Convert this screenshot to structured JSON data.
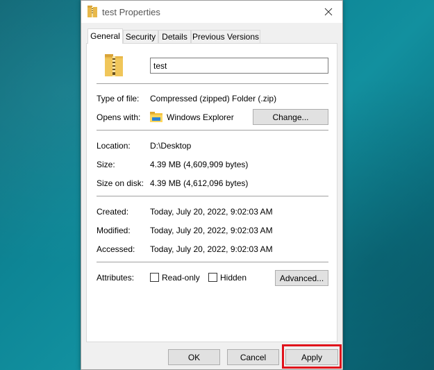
{
  "window": {
    "title": "test Properties"
  },
  "tabs": [
    {
      "label": "General",
      "active": true
    },
    {
      "label": "Security",
      "active": false
    },
    {
      "label": "Details",
      "active": false
    },
    {
      "label": "Previous Versions",
      "active": false
    }
  ],
  "general": {
    "name_value": "test",
    "type_label": "Type of file:",
    "type_value": "Compressed (zipped) Folder (.zip)",
    "opens_label": "Opens with:",
    "opens_value": "Windows Explorer",
    "change_button": "Change...",
    "location_label": "Location:",
    "location_value": "D:\\Desktop",
    "size_label": "Size:",
    "size_value": "4.39 MB (4,609,909 bytes)",
    "disk_label": "Size on disk:",
    "disk_value": "4.39 MB (4,612,096 bytes)",
    "created_label": "Created:",
    "created_value": "Today, July 20, 2022, 9:02:03 AM",
    "modified_label": "Modified:",
    "modified_value": "Today, July 20, 2022, 9:02:03 AM",
    "accessed_label": "Accessed:",
    "accessed_value": "Today, July 20, 2022, 9:02:03 AM",
    "attributes_label": "Attributes:",
    "readonly_label": "Read-only",
    "readonly_checked": false,
    "hidden_label": "Hidden",
    "hidden_checked": false,
    "advanced_button": "Advanced..."
  },
  "footer": {
    "ok_button": "OK",
    "cancel_button": "Cancel",
    "apply_button": "Apply"
  },
  "colors": {
    "highlight": "#e0121b",
    "desktop": "#0d8595",
    "folder": "#e8b84a"
  },
  "icons": {
    "title": "zip-folder-icon",
    "close": "close-icon",
    "file": "zip-folder-icon",
    "opens_with": "file-explorer-icon"
  }
}
